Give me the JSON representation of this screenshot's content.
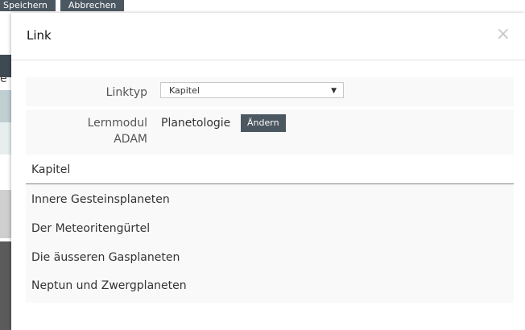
{
  "background": {
    "toolbar": {
      "save_label": "Speichern",
      "cancel_label": "Abbrechen"
    }
  },
  "modal": {
    "title": "Link",
    "close_glyph": "×",
    "link_type": {
      "label": "Linktyp",
      "selected": "Kapitel"
    },
    "module": {
      "label_line1": "Lernmodul",
      "label_line2": "ADAM",
      "value": "Planetologie",
      "change_label": "Ändern"
    },
    "chapters": {
      "header": "Kapitel",
      "items": [
        "Innere Gesteinsplaneten",
        "Der Meteoritengürtel",
        "Die äusseren Gasplaneten",
        "Neptun und Zwergplaneten"
      ]
    }
  }
}
